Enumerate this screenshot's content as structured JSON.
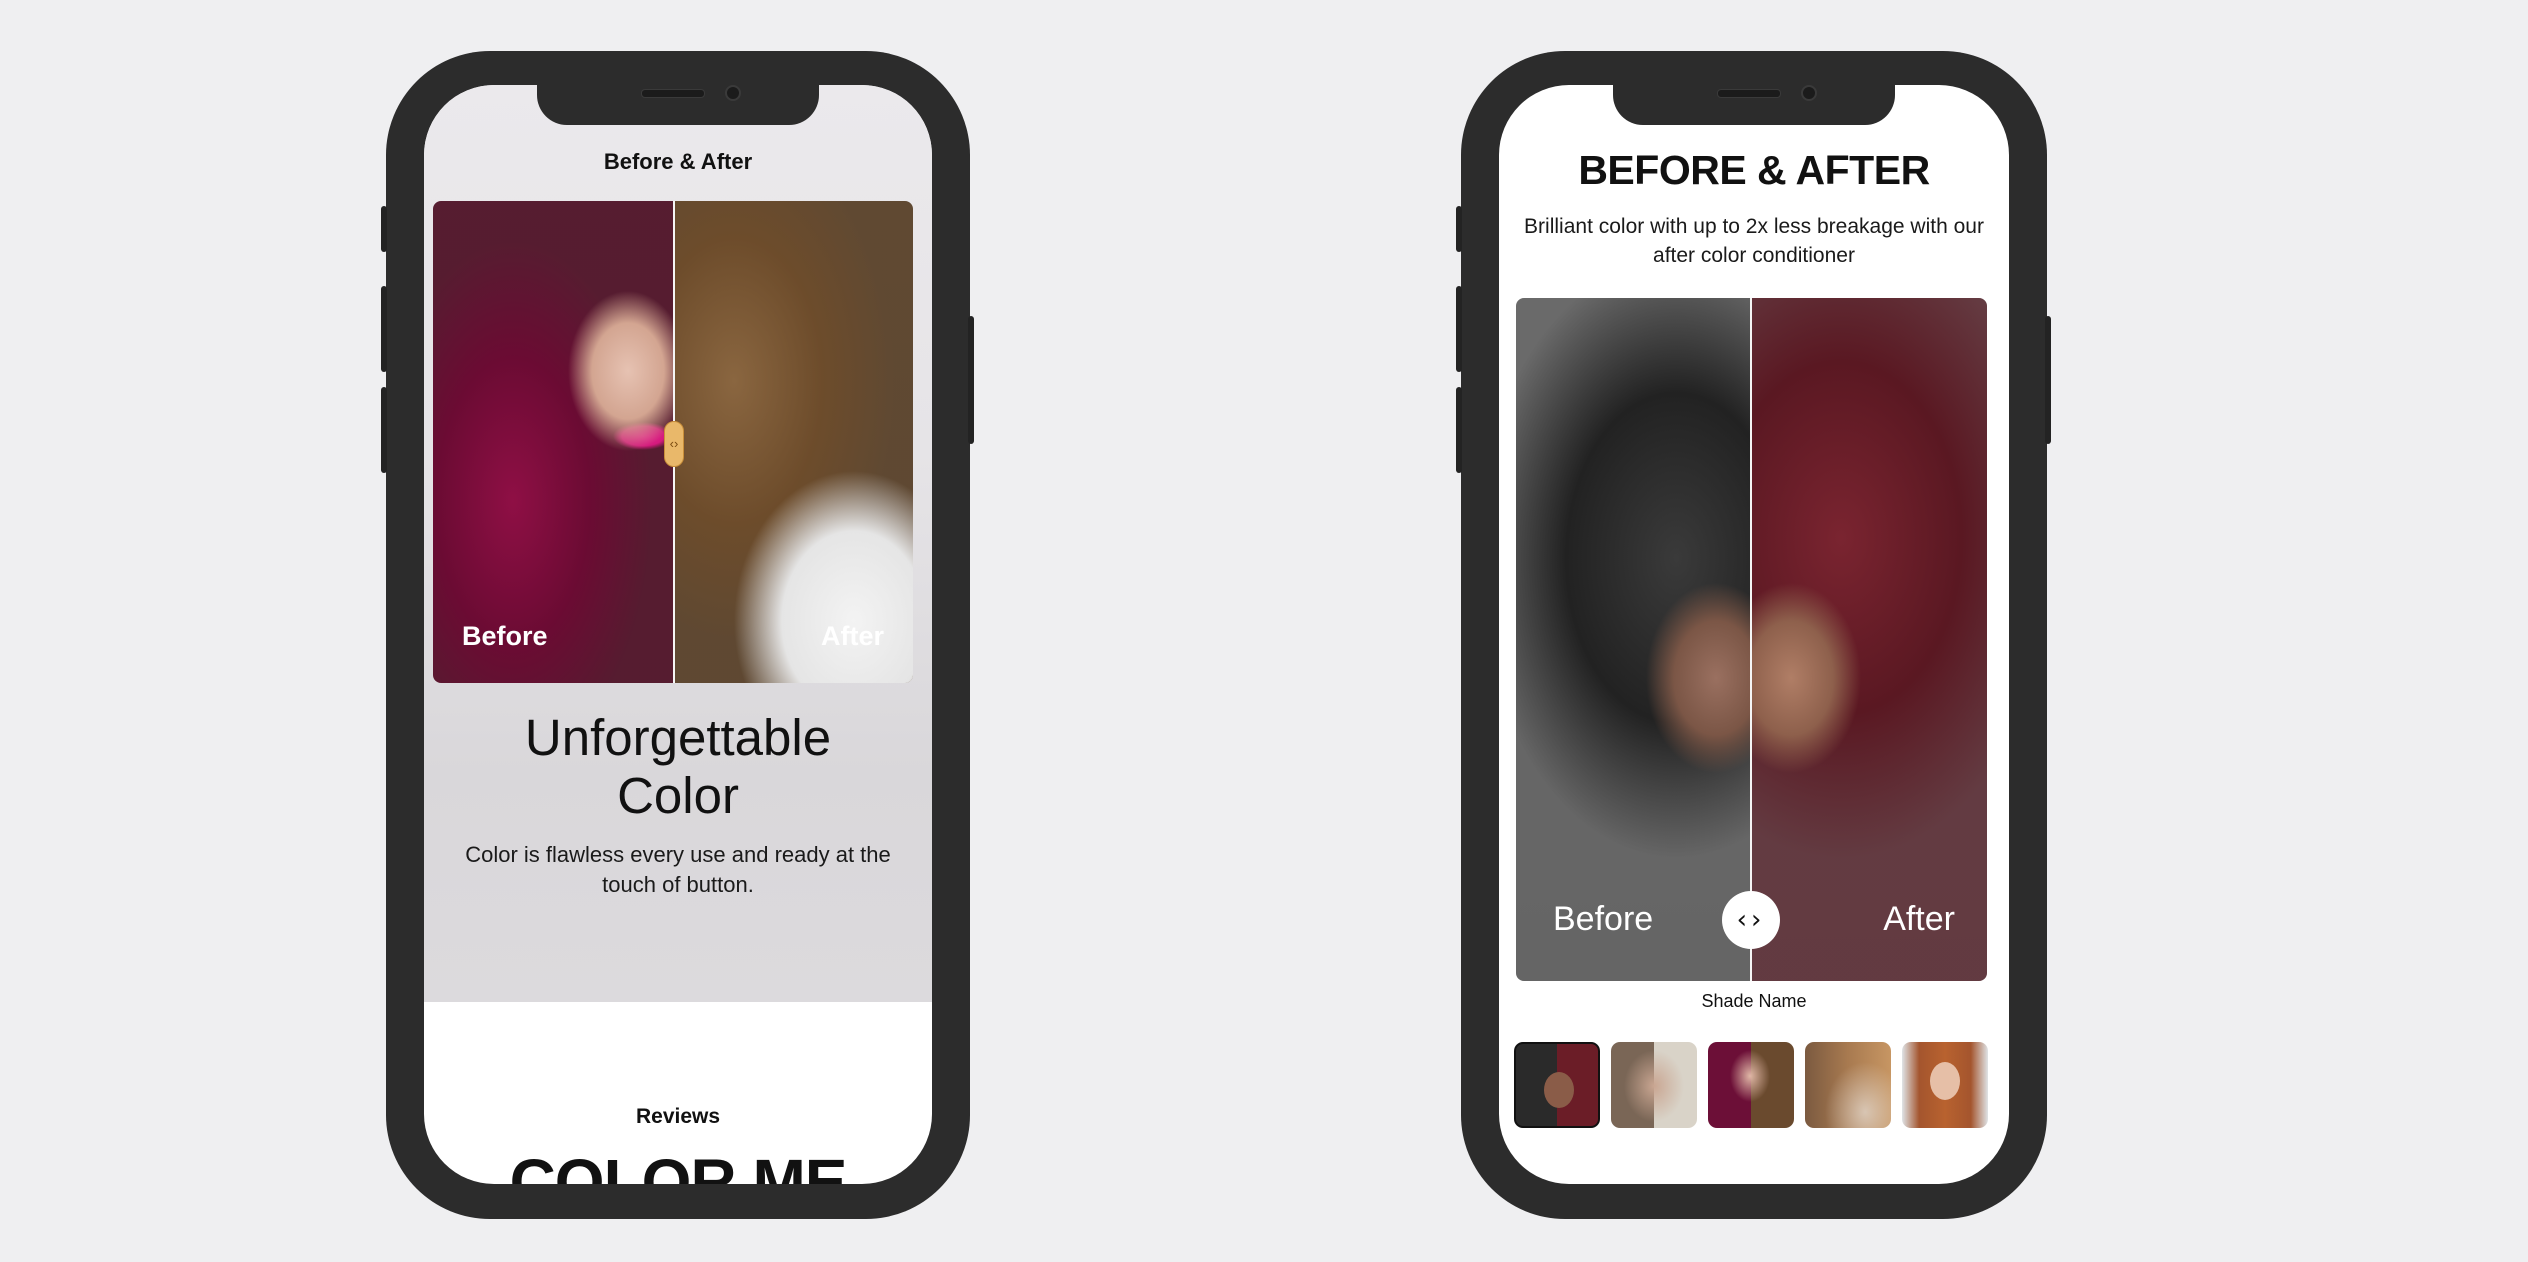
{
  "left_screen": {
    "header_title": "Before & After",
    "before_label": "Before",
    "after_label": "After",
    "heading_line1": "Unforgettable",
    "heading_line2": "Color",
    "body": "Color is flawless every use and ready at the touch of button.",
    "reviews_label": "Reviews",
    "partial_heading": "COLOR ME"
  },
  "right_screen": {
    "title": "BEFORE & AFTER",
    "subtitle": "Brilliant color with up to 2x less breakage with our after color conditioner",
    "before_label": "Before",
    "after_label": "After",
    "shade_name_label": "Shade Name",
    "thumbnails": [
      {
        "name": "curly-black-to-red",
        "selected": true
      },
      {
        "name": "bob-blonde",
        "selected": false
      },
      {
        "name": "burgundy-brunette",
        "selected": false
      },
      {
        "name": "caramel-waves",
        "selected": false
      },
      {
        "name": "copper-straight",
        "selected": false
      }
    ]
  },
  "icons": {
    "handle_left": "chevron-left-icon",
    "handle_right": "chevron-right-icon"
  },
  "colors": {
    "background": "#efeff1",
    "phone_frame": "#2c2c2c",
    "handle_gold": "#e9b86a",
    "text": "#111111"
  }
}
